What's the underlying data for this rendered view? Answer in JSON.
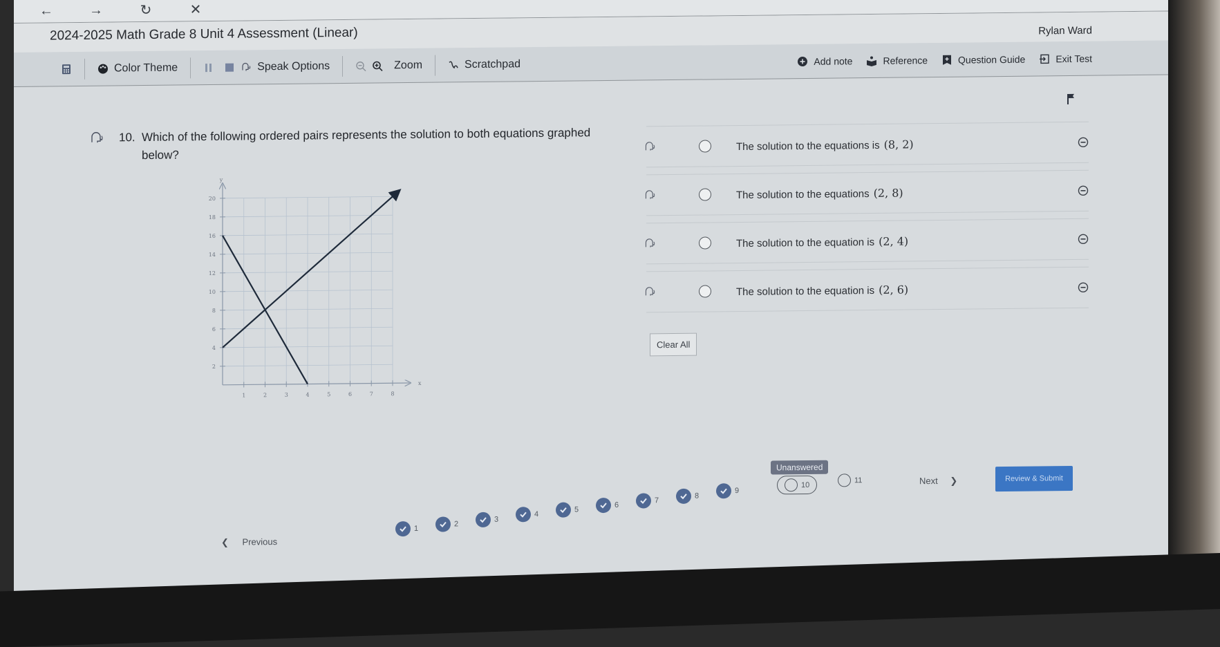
{
  "browser": {
    "back_icon": "arrow-left-icon",
    "forward_icon": "arrow-right-icon",
    "reload_icon": "reload-icon",
    "close_icon": "close-icon"
  },
  "header": {
    "title": "2024-2025 Math Grade 8 Unit 4 Assessment (Linear)",
    "user": "Rylan Ward"
  },
  "toolbar": {
    "calculator_icon": "calculator-icon",
    "color_theme": "Color Theme",
    "speak_options": "Speak Options",
    "zoom": "Zoom",
    "scratchpad": "Scratchpad",
    "add_note": "Add note",
    "reference": "Reference",
    "question_guide": "Question Guide",
    "exit_test": "Exit Test"
  },
  "question": {
    "number": "10.",
    "text": "Which of the following ordered pairs represents the solution to both equations graphed below?"
  },
  "options": [
    {
      "text": "The solution to the equations is",
      "math": "(8, 2)"
    },
    {
      "text": "The solution to the equations",
      "math": "(2, 8)"
    },
    {
      "text": "The solution to the equation is",
      "math": "(2, 4)"
    },
    {
      "text": "The solution to the equation is",
      "math": "(2, 6)"
    }
  ],
  "clear_all": "Clear All",
  "graph": {
    "x_label": "x",
    "y_label": "y",
    "x_ticks": [
      "1",
      "2",
      "3",
      "4",
      "5",
      "6",
      "7",
      "8"
    ],
    "y_ticks": [
      "2",
      "4",
      "6",
      "8",
      "10",
      "12",
      "14",
      "16",
      "18",
      "20"
    ],
    "xlim": [
      0,
      8
    ],
    "ylim": [
      0,
      20
    ],
    "lines": [
      {
        "name": "decreasing-line",
        "points": [
          [
            0,
            16
          ],
          [
            4,
            0
          ]
        ],
        "arrow": false
      },
      {
        "name": "increasing-line",
        "points": [
          [
            0,
            4
          ],
          [
            8.3,
            20.6
          ]
        ],
        "arrow": true
      }
    ]
  },
  "footer": {
    "previous": "Previous",
    "next": "Next",
    "submit": "Review & Submit",
    "tooltip": "Unanswered",
    "questions": [
      {
        "n": "1",
        "answered": true
      },
      {
        "n": "2",
        "answered": true
      },
      {
        "n": "3",
        "answered": true
      },
      {
        "n": "4",
        "answered": true
      },
      {
        "n": "5",
        "answered": true
      },
      {
        "n": "6",
        "answered": true
      },
      {
        "n": "7",
        "answered": true
      },
      {
        "n": "8",
        "answered": true
      },
      {
        "n": "9",
        "answered": true
      },
      {
        "n": "10",
        "answered": false,
        "current": true
      },
      {
        "n": "11",
        "answered": false
      }
    ]
  }
}
